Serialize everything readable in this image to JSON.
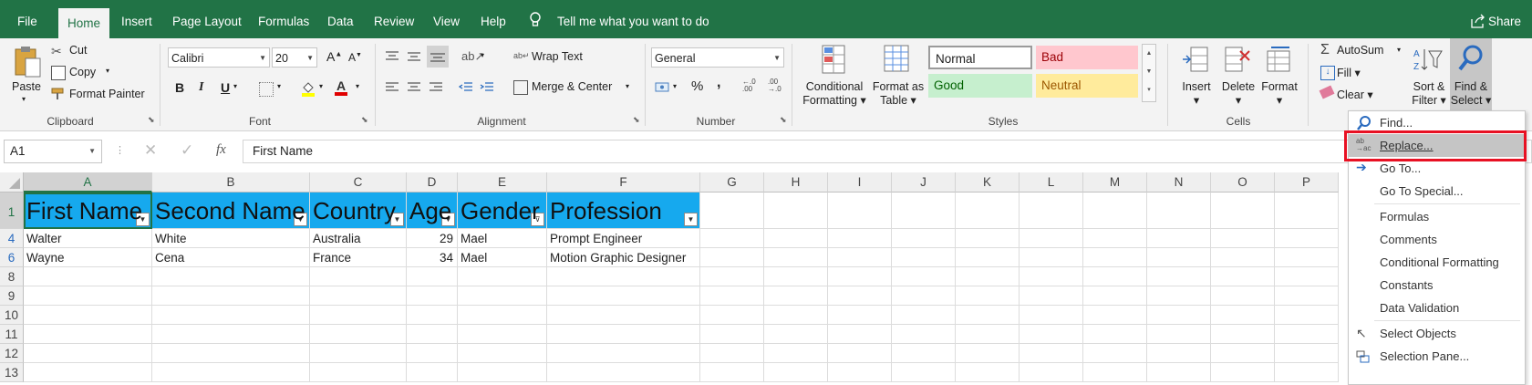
{
  "ribbon_tabs": [
    "File",
    "Home",
    "Insert",
    "Page Layout",
    "Formulas",
    "Data",
    "Review",
    "View",
    "Help"
  ],
  "active_tab": "Home",
  "tell_me": "Tell me what you want to do",
  "share": "Share",
  "clipboard": {
    "paste": "Paste",
    "cut": "Cut",
    "copy": "Copy",
    "format_painter": "Format Painter",
    "label": "Clipboard"
  },
  "font": {
    "name": "Calibri",
    "size": "20",
    "bold": "B",
    "italic": "I",
    "underline": "U",
    "grow": "A",
    "shrink": "A",
    "label": "Font"
  },
  "alignment": {
    "wrap_text": "Wrap Text",
    "merge_center": "Merge & Center",
    "label": "Alignment"
  },
  "number": {
    "format": "General",
    "percent": "%",
    "comma": ",",
    "label": "Number"
  },
  "styles": {
    "conditional": "Conditional",
    "formatting": "Formatting",
    "format_as": "Format as",
    "table": "Table",
    "normal": "Normal",
    "bad": "Bad",
    "good": "Good",
    "neutral": "Neutral",
    "label": "Styles"
  },
  "cells": {
    "insert": "Insert",
    "delete": "Delete",
    "format": "Format",
    "label": "Cells"
  },
  "editing": {
    "autosum": "AutoSum",
    "fill": "Fill",
    "clear": "Clear",
    "sort": "Sort &",
    "filter": "Filter",
    "find": "Find &",
    "select": "Select"
  },
  "name_box": "A1",
  "fx": "fx",
  "formula": "First Name",
  "columns": [
    "A",
    "B",
    "C",
    "D",
    "E",
    "F",
    "G",
    "H",
    "I",
    "J",
    "K",
    "L",
    "M",
    "N",
    "O",
    "P"
  ],
  "rows": [
    "1",
    "4",
    "6",
    "8",
    "9",
    "10",
    "11",
    "12",
    "13"
  ],
  "table_headers": [
    "First Name",
    "Second Name",
    "Country",
    "Age",
    "Gender",
    "Profession"
  ],
  "table_rows": [
    [
      "Walter",
      "White",
      "Australia",
      "29",
      "Mael",
      "Prompt Engineer"
    ],
    [
      "Wayne",
      "Cena",
      "France",
      "34",
      "Mael",
      "Motion Graphic Designer"
    ]
  ],
  "menu_items": [
    "Find...",
    "Replace...",
    "Go To...",
    "Go To Special...",
    "Formulas",
    "Comments",
    "Conditional Formatting",
    "Constants",
    "Data Validation",
    "Select Objects",
    "Selection Pane..."
  ],
  "colors": {
    "excel_green": "#217346",
    "header_fill": "#16a9ee",
    "highlight": "#e81123",
    "bad_bg": "#ffc7ce",
    "bad_fg": "#9c0006",
    "good_bg": "#c6efce",
    "good_fg": "#006100",
    "neutral_bg": "#ffeb9c",
    "neutral_fg": "#9c5700"
  }
}
